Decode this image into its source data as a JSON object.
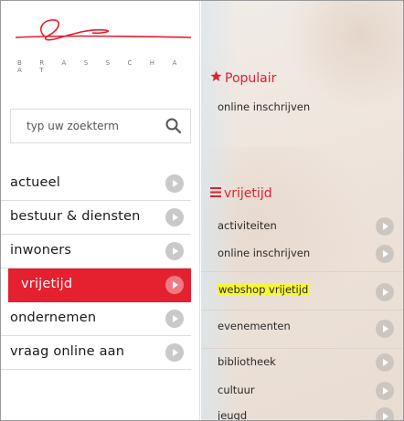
{
  "logo": {
    "text": "B R A S S C H A A T"
  },
  "search": {
    "placeholder": "typ uw zoekterm"
  },
  "nav": {
    "items": [
      {
        "label": "actueel"
      },
      {
        "label": "bestuur & diensten"
      },
      {
        "label": "inwoners"
      },
      {
        "label": "vrijetijd",
        "active": true
      },
      {
        "label": "ondernemen"
      },
      {
        "label": "vraag online aan"
      }
    ]
  },
  "popular": {
    "title": "Populair",
    "icon": "star-icon",
    "items": [
      {
        "label": "online inschrijven"
      }
    ]
  },
  "section": {
    "title": "vrijetijd",
    "icon": "menu-icon",
    "items": [
      {
        "label": "activiteiten"
      },
      {
        "label": "online inschrijven"
      },
      {
        "label": "webshop vrijetijd",
        "highlighted": true
      },
      {
        "label": "evenementen"
      },
      {
        "label": "bibliotheek"
      },
      {
        "label": "cultuur"
      },
      {
        "label": "jeugd"
      }
    ]
  },
  "colors": {
    "accent": "#e5202f",
    "highlight": "#f7f735",
    "chevron_circle": "#c9c9c9"
  }
}
